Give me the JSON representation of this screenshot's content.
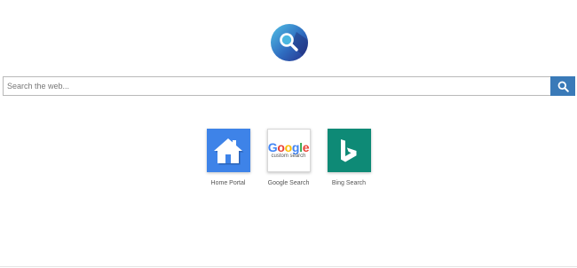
{
  "logo": {
    "icon": "magnifier-logo-icon",
    "colors": [
      "#52c2e6",
      "#2a52a8",
      "#26318a"
    ]
  },
  "search": {
    "placeholder": "Search the web...",
    "button_icon": "search-icon",
    "button_color": "#3a7ab8"
  },
  "shortcuts": [
    {
      "label": "Home Portal",
      "icon": "home-icon",
      "color": "#3e83e8"
    },
    {
      "label": "Google Search",
      "icon": "google-logo-icon",
      "wordmark": "Google",
      "sublabel": "custom search"
    },
    {
      "label": "Bing Search",
      "icon": "bing-icon",
      "color": "#0e8a76"
    }
  ]
}
